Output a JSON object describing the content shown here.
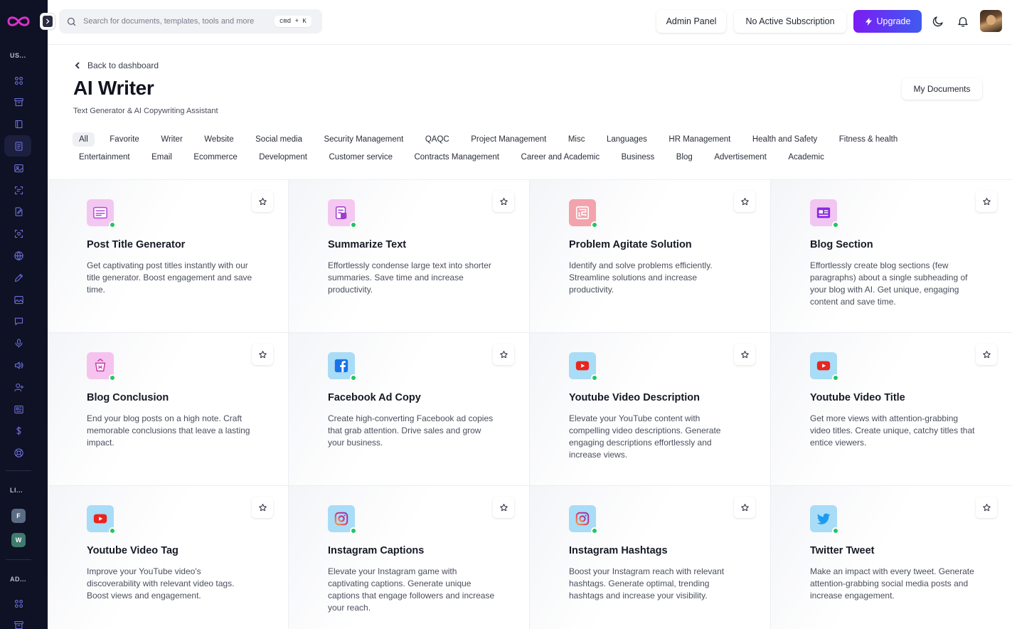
{
  "sidebar": {
    "section_user": "US...",
    "section_links": "LI...",
    "section_admin": "AD...",
    "nav_icons": [
      "grid-icon",
      "archive-icon",
      "book-icon",
      "document-icon",
      "image-icon",
      "scan-icon",
      "file-edit-icon",
      "camera-scan-icon",
      "globe-icon",
      "pen-icon",
      "photo-icon",
      "chat-icon",
      "mic-icon",
      "speaker-icon",
      "user-plus-icon",
      "cards-icon",
      "dollar-icon",
      "support-icon"
    ],
    "links": [
      {
        "letter": "F",
        "color": "#5b6b84"
      },
      {
        "letter": "W",
        "color": "#3f7a6e"
      }
    ],
    "admin_icons": [
      "grid-icon",
      "archive-icon"
    ]
  },
  "header": {
    "search_placeholder": "Search for documents, templates, tools and more",
    "shortcut": "cmd + K",
    "admin_panel": "Admin Panel",
    "subscription": "No Active Subscription",
    "upgrade": "Upgrade"
  },
  "page": {
    "back": "Back to dashboard",
    "title": "AI Writer",
    "subtitle": "Text Generator & AI Copywriting Assistant",
    "my_documents": "My Documents"
  },
  "filters_row1": [
    "All",
    "Favorite",
    "Writer",
    "Website",
    "Social media",
    "Security Management",
    "QAQC",
    "Project Management",
    "Misc",
    "Languages",
    "HR Management",
    "Health and Safety",
    "Fitness & health"
  ],
  "filters_row2": [
    "Entertainment",
    "Email",
    "Ecommerce",
    "Development",
    "Customer service",
    "Contracts Management",
    "Career and Academic",
    "Business",
    "Blog",
    "Advertisement",
    "Academic"
  ],
  "tools": [
    {
      "title": "Post Title Generator",
      "desc": "Get captivating post titles instantly with our title generator. Boost engagement and save time.",
      "icon": "post-title-icon",
      "color": "#f3c7f1",
      "accent": "#b44ad6"
    },
    {
      "title": "Summarize Text",
      "desc": "Effortlessly condense large text into shorter summaries. Save time and increase productivity.",
      "icon": "summarize-icon",
      "color": "#f4c8f0",
      "accent": "#a03ad0"
    },
    {
      "title": "Problem Agitate Solution",
      "desc": "Identify and solve problems efficiently. Streamline solutions and increase productivity.",
      "icon": "puzzle-icon",
      "color": "#f2a3ac",
      "accent": "#c63a55"
    },
    {
      "title": "Blog Section",
      "desc": "Effortlessly create blog sections (few paragraphs) about a single subheading of your blog with AI. Get unique, engaging content and save time.",
      "icon": "blog-section-icon",
      "color": "#f1c6f2",
      "accent": "#8a2ae0"
    },
    {
      "title": "Blog Conclusion",
      "desc": "End your blog posts on a high note. Craft memorable conclusions that leave a lasting impact.",
      "icon": "blog-conclusion-icon",
      "color": "#f5c3ee",
      "accent": "#c63aa8"
    },
    {
      "title": "Facebook Ad Copy",
      "desc": "Create high-converting Facebook ad copies that grab attention. Drive sales and grow your business.",
      "icon": "facebook-icon",
      "color": "#a9dcf6",
      "accent": "#1873e8"
    },
    {
      "title": "Youtube Video Description",
      "desc": "Elevate your YouTube content with compelling video descriptions. Generate engaging descriptions effortlessly and increase views.",
      "icon": "youtube-icon",
      "color": "#a9dcf6",
      "accent": "#e8251f"
    },
    {
      "title": "Youtube Video Title",
      "desc": "Get more views with attention-grabbing video titles. Create unique, catchy titles that entice viewers.",
      "icon": "youtube-icon",
      "color": "#a9dcf6",
      "accent": "#e8251f"
    },
    {
      "title": "Youtube Video Tag",
      "desc": "Improve your YouTube video's discoverability with relevant video tags. Boost views and engagement.",
      "icon": "youtube-icon",
      "color": "#a9dcf6",
      "accent": "#e8251f"
    },
    {
      "title": "Instagram Captions",
      "desc": "Elevate your Instagram game with captivating captions. Generate unique captions that engage followers and increase your reach.",
      "icon": "instagram-icon",
      "color": "#a9dcf6",
      "accent": "#d62e85"
    },
    {
      "title": "Instagram Hashtags",
      "desc": "Boost your Instagram reach with relevant hashtags. Generate optimal, trending hashtags and increase your visibility.",
      "icon": "instagram-icon",
      "color": "#a9dcf6",
      "accent": "#d62e85"
    },
    {
      "title": "Twitter Tweet",
      "desc": "Make an impact with every tweet. Generate attention-grabbing social media posts and increase engagement.",
      "icon": "twitter-icon",
      "color": "#a9dcf6",
      "accent": "#1d9bf0"
    }
  ]
}
